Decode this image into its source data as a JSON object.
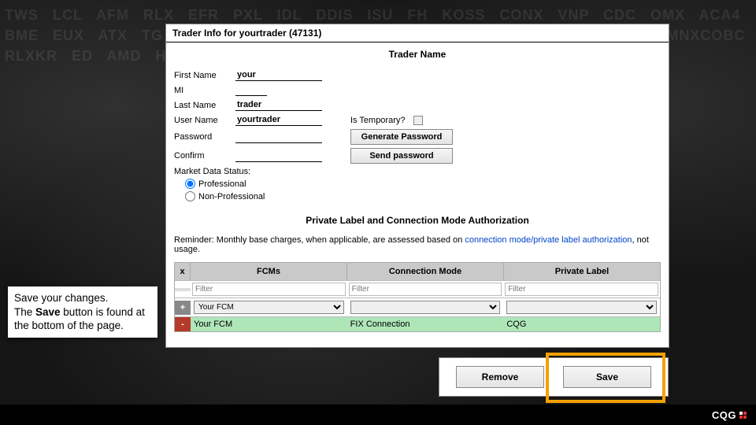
{
  "panel_title": "Trader Info for yourtrader (47131)",
  "sections": {
    "trader_name_heading": "Trader Name",
    "plabel_heading": "Private Label and Connection Mode Authorization"
  },
  "fields": {
    "first_name_label": "First Name",
    "first_name_value": "your",
    "mi_label": "MI",
    "mi_value": "",
    "last_name_label": "Last Name",
    "last_name_value": "trader",
    "user_name_label": "User Name",
    "user_name_value": "yourtrader",
    "is_temporary_label": "Is Temporary?",
    "password_label": "Password",
    "confirm_label": "Confirm",
    "generate_password_btn": "Generate Password",
    "send_password_btn": "Send password",
    "mds_label": "Market Data Status:",
    "mds_opt_pro": "Professional",
    "mds_opt_nonpro": "Non-Professional"
  },
  "reminder": {
    "prefix": "Reminder: Monthly base charges, when applicable, are assessed based on ",
    "link": "connection mode/private label authorization",
    "suffix": ", not usage."
  },
  "grid": {
    "headers": {
      "x": "x",
      "fcms": "FCMs",
      "conn": "Connection Mode",
      "plabel": "Private Label"
    },
    "filter_placeholder": "Filter",
    "add": {
      "icon": "+",
      "fcm_options": [
        "Your FCM"
      ],
      "fcm_selected": "Your FCM"
    },
    "row": {
      "icon": "-",
      "fcm": "Your FCM",
      "conn": "FIX Connection",
      "plabel": "CQG"
    }
  },
  "callout": {
    "line1": "Save your changes.",
    "line2_a": "The ",
    "line2_b": "Save",
    "line2_c": " button is found at the bottom of the page."
  },
  "actions": {
    "remove": "Remove",
    "save": "Save"
  },
  "footer_logo": "CQG"
}
